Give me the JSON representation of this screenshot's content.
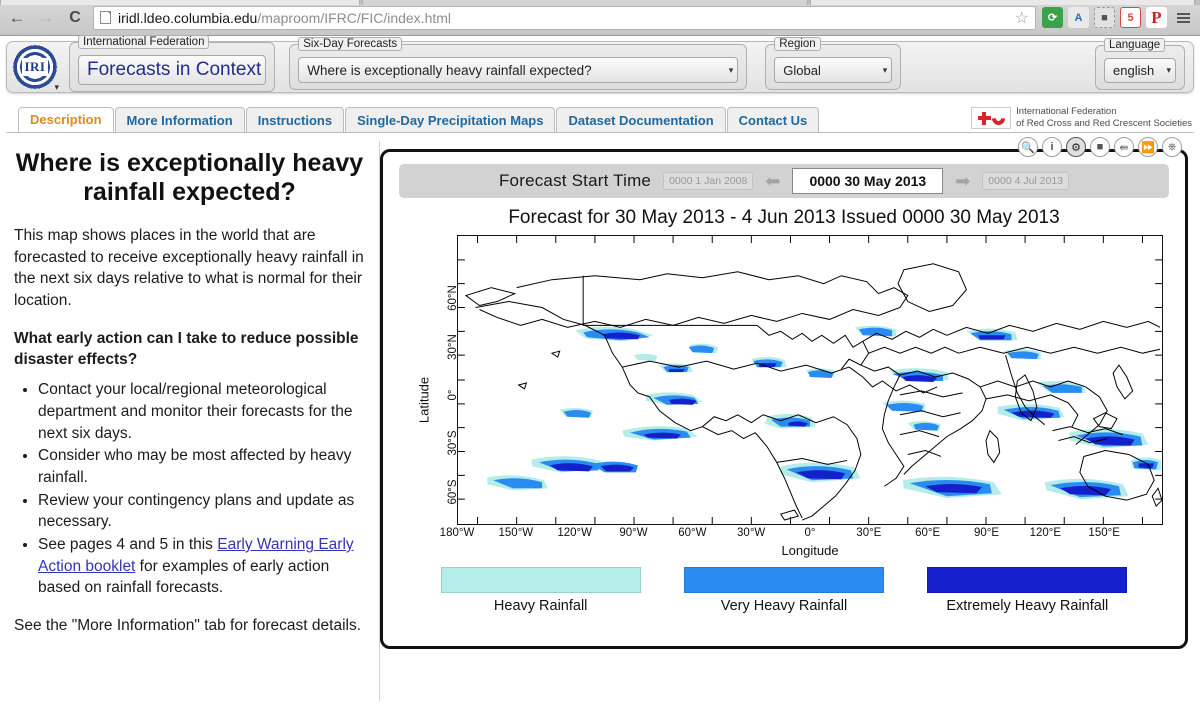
{
  "browser": {
    "back_icon": "back-arrow-icon",
    "forward_icon": "forward-arrow-icon",
    "reload_icon": "reload-icon",
    "url_host": "iridl.ldeo.columbia.edu",
    "url_path": "/maproom/IFRC/FIC/index.html",
    "url_full": "iridl.ldeo.columbia.edu/maproom/IFRC/FIC/index.html",
    "star_icon": "bookmark-star-icon",
    "extensions": [
      {
        "name": "sync-extension-icon",
        "glyph": "⟳"
      },
      {
        "name": "translate-extension-icon",
        "glyph": "A"
      },
      {
        "name": "evernote-extension-icon",
        "glyph": "■"
      },
      {
        "name": "calendar-extension-icon",
        "glyph": "5"
      },
      {
        "name": "pinterest-extension-icon",
        "glyph": "P"
      }
    ],
    "menu_icon": "hamburger-menu-icon"
  },
  "banner": {
    "logo_text": "IRI",
    "title_legend": "International Federation",
    "title_value": "Forecasts in Context",
    "forecast_legend": "Six-Day Forecasts",
    "forecast_value": "Where is exceptionally heavy rainfall expected?",
    "region_legend": "Region",
    "region_value": "Global",
    "language_legend": "Language",
    "language_value": "english",
    "caret": "▾"
  },
  "tabs": [
    {
      "label": "Description",
      "active": true
    },
    {
      "label": "More Information",
      "active": false
    },
    {
      "label": "Instructions",
      "active": false
    },
    {
      "label": "Single-Day Precipitation Maps",
      "active": false
    },
    {
      "label": "Dataset Documentation",
      "active": false
    },
    {
      "label": "Contact Us",
      "active": false
    }
  ],
  "ifrc": {
    "line1": "International Federation",
    "line2": "of Red Cross and Red Crescent Societies"
  },
  "description": {
    "title": "Where is exceptionally heavy rainfall expected?",
    "intro": "This map shows places in the world that are forecasted to receive exceptionally heavy rainfall in the next six days relative to what is normal for their location.",
    "question": "What early action can I take to reduce possible disaster effects?",
    "bullets": [
      {
        "text": "Contact your local/regional meteorological department and monitor their forecasts for the next six days."
      },
      {
        "text": "Consider who may be most affected by heavy rainfall."
      },
      {
        "text": "Review your contingency plans and update as necessary."
      },
      {
        "text_before": "See pages 4 and 5 in this ",
        "link": "Early Warning Early Action booklet",
        "text_after": " for examples of early action based on rainfall forecasts."
      }
    ],
    "footer": "See the \"More Information\" tab for forecast details."
  },
  "panel": {
    "toolbar_icons": [
      {
        "name": "zoom-icon",
        "glyph": "🔍"
      },
      {
        "name": "info-icon",
        "glyph": "i"
      },
      {
        "name": "settings-gear-icon",
        "glyph": "⚙"
      },
      {
        "name": "stop-square-icon",
        "glyph": "■"
      },
      {
        "name": "share-icon",
        "glyph": "≪"
      },
      {
        "name": "download-icon",
        "glyph": "⤓"
      },
      {
        "name": "power-icon",
        "glyph": "⏻"
      }
    ],
    "time_label": "Forecast Start Time",
    "time_min": "0000 1 Jan 2008",
    "time_current": "0000 30 May 2013",
    "time_max": "0000 4 Jul 2013",
    "prev_arrow": "⬅",
    "next_arrow": "➡",
    "map_title": "Forecast for 30 May 2013 - 4 Jun 2013 Issued 0000 30 May 2013"
  },
  "chart_data": {
    "type": "heatmap",
    "title": "Forecast for 30 May 2013 - 4 Jun 2013 Issued 0000 30 May 2013",
    "xlabel": "Longitude",
    "ylabel": "Latitude",
    "xlim": [
      -180,
      180
    ],
    "ylim": [
      -90,
      90
    ],
    "grid": false,
    "xticks": [
      {
        "value": -180,
        "label": "180°W"
      },
      {
        "value": -150,
        "label": "150°W"
      },
      {
        "value": -120,
        "label": "120°W"
      },
      {
        "value": -90,
        "label": "90°W"
      },
      {
        "value": -60,
        "label": "60°W"
      },
      {
        "value": -30,
        "label": "30°W"
      },
      {
        "value": 0,
        "label": "0°"
      },
      {
        "value": 30,
        "label": "30°E"
      },
      {
        "value": 60,
        "label": "60°E"
      },
      {
        "value": 90,
        "label": "90°E"
      },
      {
        "value": 120,
        "label": "120°E"
      },
      {
        "value": 150,
        "label": "150°E"
      }
    ],
    "yticks": [
      {
        "value": 60,
        "label": "60°N"
      },
      {
        "value": 30,
        "label": "30°N"
      },
      {
        "value": 0,
        "label": "0°"
      },
      {
        "value": -30,
        "label": "30°S"
      },
      {
        "value": -60,
        "label": "60°S"
      }
    ],
    "legend_position": "bottom",
    "legend": [
      {
        "label": "Heavy Rainfall",
        "color": "#b3ece8"
      },
      {
        "label": "Very Heavy Rainfall",
        "color": "#2a8cf0"
      },
      {
        "label": "Extremely Heavy Rainfall",
        "color": "#1320cc"
      }
    ]
  }
}
